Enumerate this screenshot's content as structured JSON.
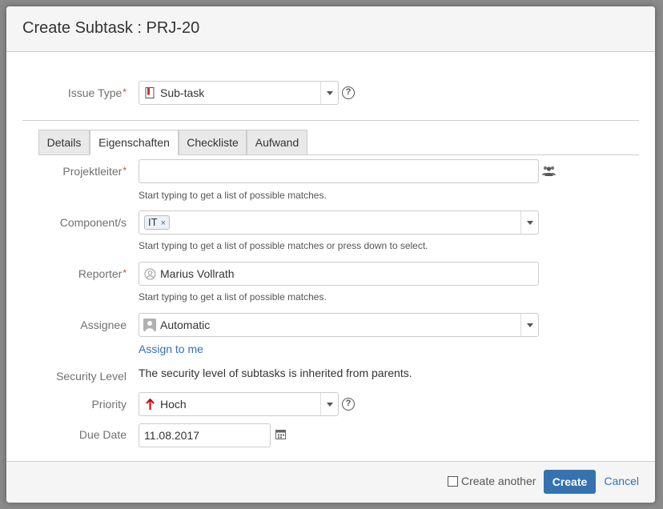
{
  "dialog": {
    "title": "Create Subtask : PRJ-20"
  },
  "issue_type": {
    "label": "Issue Type",
    "value": "Sub-task",
    "help_icon": "question-circle-icon"
  },
  "tabs": [
    {
      "label": "Details"
    },
    {
      "label": "Eigenschaften"
    },
    {
      "label": "Checkliste"
    },
    {
      "label": "Aufwand"
    }
  ],
  "active_tab": "Eigenschaften",
  "projektleiter": {
    "label": "Projektleiter",
    "value": "",
    "hint": "Start typing to get a list of possible matches.",
    "icon": "user-group-icon"
  },
  "components": {
    "label": "Component/s",
    "tag": "IT",
    "remove": "×",
    "hint": "Start typing to get a list of possible matches or press down to select."
  },
  "reporter": {
    "label": "Reporter",
    "value": "Marius Vollrath",
    "hint": "Start typing to get a list of possible matches."
  },
  "assignee": {
    "label": "Assignee",
    "value": "Automatic",
    "assign_link": "Assign to me"
  },
  "security": {
    "label": "Security Level",
    "text": "The security level of subtasks is inherited from parents."
  },
  "priority": {
    "label": "Priority",
    "value": "Hoch",
    "color": "#cc0000"
  },
  "due_date": {
    "label": "Due Date",
    "value": "11.08.2017",
    "icon": "calendar-icon"
  },
  "required_marker": "*",
  "footer": {
    "create_another": "Create another",
    "create": "Create",
    "cancel": "Cancel"
  }
}
